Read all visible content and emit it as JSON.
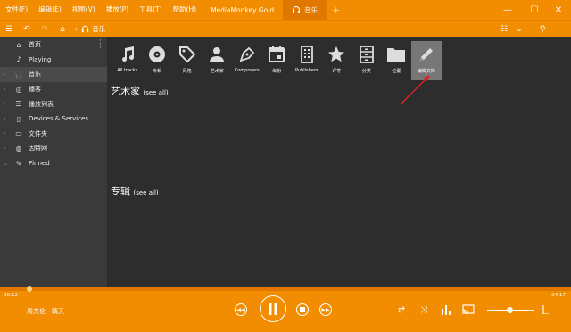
{
  "menu": {
    "file": "文件(F)",
    "edit": "编辑(E)",
    "view": "视图(V)",
    "play": "播放(P)",
    "tools": "工具(T)",
    "help": "帮助(H)"
  },
  "tabs": [
    {
      "label": "MediaMonkey Gold"
    },
    {
      "label": "音乐"
    }
  ],
  "breadcrumb": {
    "current": "音乐"
  },
  "sidebar": {
    "items": [
      {
        "label": "首页",
        "icon": "home-icon"
      },
      {
        "label": "Playing",
        "icon": "music-note-icon"
      },
      {
        "label": "音乐",
        "icon": "headphones-icon"
      },
      {
        "label": "播客",
        "icon": "podcast-icon"
      },
      {
        "label": "播放列表",
        "icon": "playlist-icon"
      },
      {
        "label": "Devices & Services",
        "icon": "device-icon"
      },
      {
        "label": "文件夹",
        "icon": "laptop-icon"
      },
      {
        "label": "因特网",
        "icon": "globe-icon"
      },
      {
        "label": "Pinned",
        "icon": "pin-icon"
      }
    ]
  },
  "categories": [
    {
      "label": "All tracks",
      "icon": "music-notes-icon"
    },
    {
      "label": "专辑",
      "icon": "disc-icon"
    },
    {
      "label": "风格",
      "icon": "tag-icon"
    },
    {
      "label": "艺术家",
      "icon": "person-icon"
    },
    {
      "label": "Composers",
      "icon": "pen-nib-icon"
    },
    {
      "label": "年份",
      "icon": "calendar-icon"
    },
    {
      "label": "Publishers",
      "icon": "building-icon"
    },
    {
      "label": "评等",
      "icon": "star-icon"
    },
    {
      "label": "分类",
      "icon": "cabinet-icon"
    },
    {
      "label": "位置",
      "icon": "folder-icon"
    },
    {
      "label": "编辑文档",
      "icon": "pencil-icon"
    }
  ],
  "sections": {
    "artists": {
      "title": "艺术家",
      "see_all": "(see all)"
    },
    "albums": {
      "title": "专辑",
      "see_all": "(see all)"
    }
  },
  "player": {
    "elapsed": "00:12",
    "remaining": "-04:17",
    "track": "周杰伦 - 晴天",
    "progress_percent": 5,
    "volume_percent": 45
  },
  "colors": {
    "accent": "#f28c00",
    "sidebar_bg": "#3a3a3a",
    "main_bg": "#2d2d2d",
    "annotation_arrow": "#e02020"
  }
}
